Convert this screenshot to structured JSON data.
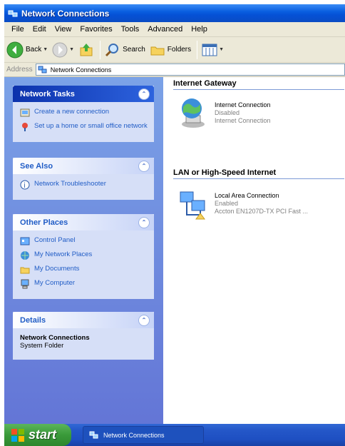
{
  "window": {
    "title": "Network Connections"
  },
  "menu": {
    "items": [
      "File",
      "Edit",
      "View",
      "Favorites",
      "Tools",
      "Advanced",
      "Help"
    ]
  },
  "toolbar": {
    "back_label": "Back",
    "search_label": "Search",
    "folders_label": "Folders"
  },
  "address": {
    "label": "Address",
    "value": "Network Connections"
  },
  "task_pane": {
    "network_tasks": {
      "title": "Network Tasks",
      "items": [
        "Create a new connection",
        "Set up a home or small office network"
      ]
    },
    "see_also": {
      "title": "See Also",
      "items": [
        "Network Troubleshooter"
      ]
    },
    "other_places": {
      "title": "Other Places",
      "items": [
        "Control Panel",
        "My Network Places",
        "My Documents",
        "My Computer"
      ]
    },
    "details": {
      "title": "Details",
      "name": "Network Connections",
      "type": "System Folder"
    }
  },
  "content": {
    "groups": [
      {
        "title": "Internet Gateway",
        "items": [
          {
            "name": "Internet Connection",
            "status": "Disabled",
            "type": "Internet Connection"
          }
        ]
      },
      {
        "title": "LAN or High-Speed Internet",
        "items": [
          {
            "name": "Local Area Connection",
            "status": "Enabled",
            "type": "Accton EN1207D-TX PCI Fast ..."
          }
        ]
      }
    ]
  },
  "taskbar": {
    "start_label": "start",
    "window_button_label": "Network Connections"
  },
  "colors": {
    "title_bar": "#0a5fe0",
    "task_pane": "#6f8ee0",
    "link": "#215dc6",
    "start_button": "#3a9a3a"
  }
}
